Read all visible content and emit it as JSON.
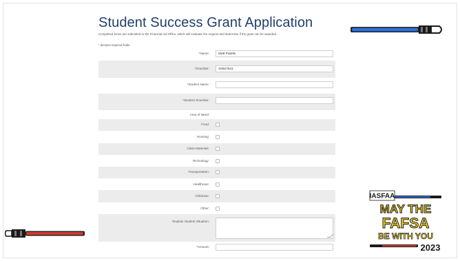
{
  "page": {
    "title": "Student Success Grant Application",
    "intro": "Completed forms are submitted to the Financial Aid Office, which will evaluate the request and determine if the grant can be awarded.",
    "required_note": "* denotes required fields."
  },
  "form": {
    "name": {
      "label": "*Name:",
      "value": "Matt Patello"
    },
    "xnumber": {
      "label": "*Xnumber:",
      "value": "X0927641"
    },
    "student_name": {
      "label": "*Student Name:",
      "value": ""
    },
    "student_xnumber": {
      "label": "*Student Xnumber:",
      "value": ""
    },
    "area_of_need_label": "Area of Need:",
    "needs": [
      {
        "label": "Food:"
      },
      {
        "label": "Housing:"
      },
      {
        "label": "Class Materials:"
      },
      {
        "label": "Technology:"
      },
      {
        "label": "Transportation:"
      },
      {
        "label": "Healthcare:"
      },
      {
        "label": "Childcare:"
      },
      {
        "label": "Other:"
      }
    ],
    "explain": {
      "label": "*Explain Student Situation:",
      "value": ""
    },
    "amount": {
      "label": "*Amount:",
      "value": ""
    }
  },
  "badge": {
    "org": "IASFAA",
    "line1": "MAY THE",
    "line2": "FAFSA",
    "line3": "BE WITH YOU",
    "year": "2023"
  },
  "colors": {
    "title": "#1f3f6b",
    "shade_row": "#ececec",
    "saber_blue": "#2f6fd6",
    "saber_red": "#d23a2f",
    "badge_yellow": "#f4d21f"
  }
}
